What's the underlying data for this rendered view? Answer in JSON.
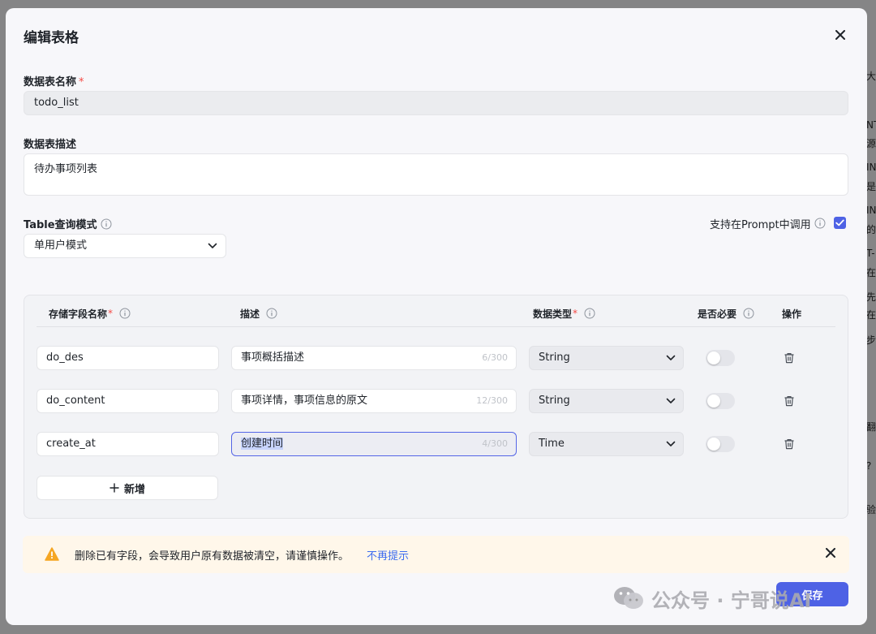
{
  "background": {
    "fragments_right": [
      "大",
      "NT",
      "源",
      "IN",
      "是",
      "IN",
      "的",
      "T-",
      "在",
      "先",
      "在",
      "步",
      "翻",
      "?",
      "验"
    ]
  },
  "dialog": {
    "title": "编辑表格",
    "close_icon": "close-icon"
  },
  "table_name": {
    "label": "数据表名称",
    "required": "*",
    "value": "todo_list"
  },
  "table_desc": {
    "label": "数据表描述",
    "value": "待办事项列表"
  },
  "query_mode": {
    "label": "Table查询模式",
    "selected": "单用户模式"
  },
  "prompt_support": {
    "label": "支持在Prompt中调用",
    "checked": true
  },
  "fields_table": {
    "headers": {
      "name": "存储字段名称",
      "desc": "描述",
      "type": "数据类型",
      "required": "是否必要",
      "actions": "操作"
    },
    "required_star": "*",
    "rows": [
      {
        "name": "do_des",
        "desc": "事项概括描述",
        "counter": "6/300",
        "type": "String",
        "required_on": false
      },
      {
        "name": "do_content",
        "desc": "事项详情，事项信息的原文",
        "counter": "12/300",
        "type": "String",
        "required_on": false
      },
      {
        "name": "create_at",
        "desc": "创建时间",
        "counter": "4/300",
        "type": "Time",
        "required_on": false
      }
    ],
    "add_label": "新增"
  },
  "warning": {
    "text": "删除已有字段，会导致用户原有数据被清空，请谨慎操作。",
    "link": "不再提示"
  },
  "save_label": "保存",
  "watermark": {
    "text": "公众号 · 宁哥说AI"
  },
  "colors": {
    "primary": "#4e62e5",
    "required": "#f54a45",
    "warning_bg": "#fff7ea",
    "warning_icon": "#f5a623",
    "link": "#3c6cf0"
  }
}
